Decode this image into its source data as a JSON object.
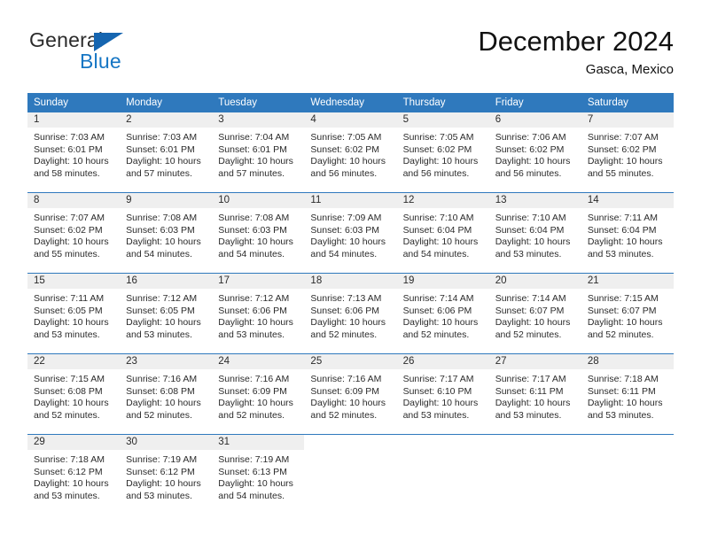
{
  "brand": {
    "name_top": "General",
    "name_bottom": "Blue",
    "triangle_color": "#1565b0",
    "blue_color": "#1676c4"
  },
  "header": {
    "title": "December 2024",
    "location": "Gasca, Mexico"
  },
  "theme": {
    "header_blue": "#2f79bd",
    "daynum_background": "#efefef",
    "text": "#2b2b2b"
  },
  "labels": {
    "sunrise_prefix": "Sunrise:",
    "sunset_prefix": "Sunset:",
    "daylight_prefix": "Daylight:"
  },
  "weekdays": [
    "Sunday",
    "Monday",
    "Tuesday",
    "Wednesday",
    "Thursday",
    "Friday",
    "Saturday"
  ],
  "weeks": [
    [
      {
        "day": "1",
        "sunrise": "Sunrise: 7:03 AM",
        "sunset": "Sunset: 6:01 PM",
        "daylight_line1": "Daylight: 10 hours",
        "daylight_line2": "and 58 minutes."
      },
      {
        "day": "2",
        "sunrise": "Sunrise: 7:03 AM",
        "sunset": "Sunset: 6:01 PM",
        "daylight_line1": "Daylight: 10 hours",
        "daylight_line2": "and 57 minutes."
      },
      {
        "day": "3",
        "sunrise": "Sunrise: 7:04 AM",
        "sunset": "Sunset: 6:01 PM",
        "daylight_line1": "Daylight: 10 hours",
        "daylight_line2": "and 57 minutes."
      },
      {
        "day": "4",
        "sunrise": "Sunrise: 7:05 AM",
        "sunset": "Sunset: 6:02 PM",
        "daylight_line1": "Daylight: 10 hours",
        "daylight_line2": "and 56 minutes."
      },
      {
        "day": "5",
        "sunrise": "Sunrise: 7:05 AM",
        "sunset": "Sunset: 6:02 PM",
        "daylight_line1": "Daylight: 10 hours",
        "daylight_line2": "and 56 minutes."
      },
      {
        "day": "6",
        "sunrise": "Sunrise: 7:06 AM",
        "sunset": "Sunset: 6:02 PM",
        "daylight_line1": "Daylight: 10 hours",
        "daylight_line2": "and 56 minutes."
      },
      {
        "day": "7",
        "sunrise": "Sunrise: 7:07 AM",
        "sunset": "Sunset: 6:02 PM",
        "daylight_line1": "Daylight: 10 hours",
        "daylight_line2": "and 55 minutes."
      }
    ],
    [
      {
        "day": "8",
        "sunrise": "Sunrise: 7:07 AM",
        "sunset": "Sunset: 6:02 PM",
        "daylight_line1": "Daylight: 10 hours",
        "daylight_line2": "and 55 minutes."
      },
      {
        "day": "9",
        "sunrise": "Sunrise: 7:08 AM",
        "sunset": "Sunset: 6:03 PM",
        "daylight_line1": "Daylight: 10 hours",
        "daylight_line2": "and 54 minutes."
      },
      {
        "day": "10",
        "sunrise": "Sunrise: 7:08 AM",
        "sunset": "Sunset: 6:03 PM",
        "daylight_line1": "Daylight: 10 hours",
        "daylight_line2": "and 54 minutes."
      },
      {
        "day": "11",
        "sunrise": "Sunrise: 7:09 AM",
        "sunset": "Sunset: 6:03 PM",
        "daylight_line1": "Daylight: 10 hours",
        "daylight_line2": "and 54 minutes."
      },
      {
        "day": "12",
        "sunrise": "Sunrise: 7:10 AM",
        "sunset": "Sunset: 6:04 PM",
        "daylight_line1": "Daylight: 10 hours",
        "daylight_line2": "and 54 minutes."
      },
      {
        "day": "13",
        "sunrise": "Sunrise: 7:10 AM",
        "sunset": "Sunset: 6:04 PM",
        "daylight_line1": "Daylight: 10 hours",
        "daylight_line2": "and 53 minutes."
      },
      {
        "day": "14",
        "sunrise": "Sunrise: 7:11 AM",
        "sunset": "Sunset: 6:04 PM",
        "daylight_line1": "Daylight: 10 hours",
        "daylight_line2": "and 53 minutes."
      }
    ],
    [
      {
        "day": "15",
        "sunrise": "Sunrise: 7:11 AM",
        "sunset": "Sunset: 6:05 PM",
        "daylight_line1": "Daylight: 10 hours",
        "daylight_line2": "and 53 minutes."
      },
      {
        "day": "16",
        "sunrise": "Sunrise: 7:12 AM",
        "sunset": "Sunset: 6:05 PM",
        "daylight_line1": "Daylight: 10 hours",
        "daylight_line2": "and 53 minutes."
      },
      {
        "day": "17",
        "sunrise": "Sunrise: 7:12 AM",
        "sunset": "Sunset: 6:06 PM",
        "daylight_line1": "Daylight: 10 hours",
        "daylight_line2": "and 53 minutes."
      },
      {
        "day": "18",
        "sunrise": "Sunrise: 7:13 AM",
        "sunset": "Sunset: 6:06 PM",
        "daylight_line1": "Daylight: 10 hours",
        "daylight_line2": "and 52 minutes."
      },
      {
        "day": "19",
        "sunrise": "Sunrise: 7:14 AM",
        "sunset": "Sunset: 6:06 PM",
        "daylight_line1": "Daylight: 10 hours",
        "daylight_line2": "and 52 minutes."
      },
      {
        "day": "20",
        "sunrise": "Sunrise: 7:14 AM",
        "sunset": "Sunset: 6:07 PM",
        "daylight_line1": "Daylight: 10 hours",
        "daylight_line2": "and 52 minutes."
      },
      {
        "day": "21",
        "sunrise": "Sunrise: 7:15 AM",
        "sunset": "Sunset: 6:07 PM",
        "daylight_line1": "Daylight: 10 hours",
        "daylight_line2": "and 52 minutes."
      }
    ],
    [
      {
        "day": "22",
        "sunrise": "Sunrise: 7:15 AM",
        "sunset": "Sunset: 6:08 PM",
        "daylight_line1": "Daylight: 10 hours",
        "daylight_line2": "and 52 minutes."
      },
      {
        "day": "23",
        "sunrise": "Sunrise: 7:16 AM",
        "sunset": "Sunset: 6:08 PM",
        "daylight_line1": "Daylight: 10 hours",
        "daylight_line2": "and 52 minutes."
      },
      {
        "day": "24",
        "sunrise": "Sunrise: 7:16 AM",
        "sunset": "Sunset: 6:09 PM",
        "daylight_line1": "Daylight: 10 hours",
        "daylight_line2": "and 52 minutes."
      },
      {
        "day": "25",
        "sunrise": "Sunrise: 7:16 AM",
        "sunset": "Sunset: 6:09 PM",
        "daylight_line1": "Daylight: 10 hours",
        "daylight_line2": "and 52 minutes."
      },
      {
        "day": "26",
        "sunrise": "Sunrise: 7:17 AM",
        "sunset": "Sunset: 6:10 PM",
        "daylight_line1": "Daylight: 10 hours",
        "daylight_line2": "and 53 minutes."
      },
      {
        "day": "27",
        "sunrise": "Sunrise: 7:17 AM",
        "sunset": "Sunset: 6:11 PM",
        "daylight_line1": "Daylight: 10 hours",
        "daylight_line2": "and 53 minutes."
      },
      {
        "day": "28",
        "sunrise": "Sunrise: 7:18 AM",
        "sunset": "Sunset: 6:11 PM",
        "daylight_line1": "Daylight: 10 hours",
        "daylight_line2": "and 53 minutes."
      }
    ],
    [
      {
        "day": "29",
        "sunrise": "Sunrise: 7:18 AM",
        "sunset": "Sunset: 6:12 PM",
        "daylight_line1": "Daylight: 10 hours",
        "daylight_line2": "and 53 minutes."
      },
      {
        "day": "30",
        "sunrise": "Sunrise: 7:19 AM",
        "sunset": "Sunset: 6:12 PM",
        "daylight_line1": "Daylight: 10 hours",
        "daylight_line2": "and 53 minutes."
      },
      {
        "day": "31",
        "sunrise": "Sunrise: 7:19 AM",
        "sunset": "Sunset: 6:13 PM",
        "daylight_line1": "Daylight: 10 hours",
        "daylight_line2": "and 54 minutes."
      },
      {
        "day": "",
        "sunrise": "",
        "sunset": "",
        "daylight_line1": "",
        "daylight_line2": ""
      },
      {
        "day": "",
        "sunrise": "",
        "sunset": "",
        "daylight_line1": "",
        "daylight_line2": ""
      },
      {
        "day": "",
        "sunrise": "",
        "sunset": "",
        "daylight_line1": "",
        "daylight_line2": ""
      },
      {
        "day": "",
        "sunrise": "",
        "sunset": "",
        "daylight_line1": "",
        "daylight_line2": ""
      }
    ]
  ]
}
